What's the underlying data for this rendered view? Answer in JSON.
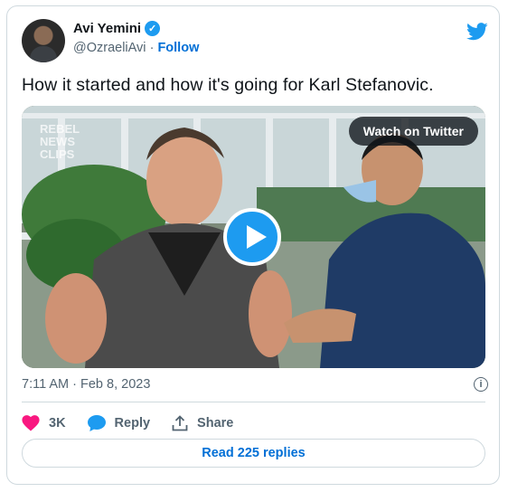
{
  "author": {
    "name": "Avi Yemini",
    "handle": "@OzraeliAvi",
    "separator": "·",
    "follow_label": "Follow"
  },
  "tweet": {
    "text": "How it started and how it's going for Karl Stefanovic."
  },
  "media": {
    "watch_label": "Watch on Twitter",
    "overlay_logo_text": "REBEL NEWS CLIPS"
  },
  "meta": {
    "timestamp": "7:11 AM · Feb 8, 2023"
  },
  "actions": {
    "like_count": "3K",
    "reply_label": "Reply",
    "share_label": "Share",
    "read_replies_label": "Read 225 replies"
  },
  "colors": {
    "twitter_blue": "#1d9bf0",
    "link_blue": "#006fd6",
    "heart_pink": "#f91880",
    "secondary_text": "#536471",
    "border": "#cfd9de"
  },
  "icons": [
    "verified-icon",
    "twitter-bird-icon",
    "play-icon",
    "info-icon",
    "heart-icon",
    "reply-icon",
    "share-icon"
  ]
}
